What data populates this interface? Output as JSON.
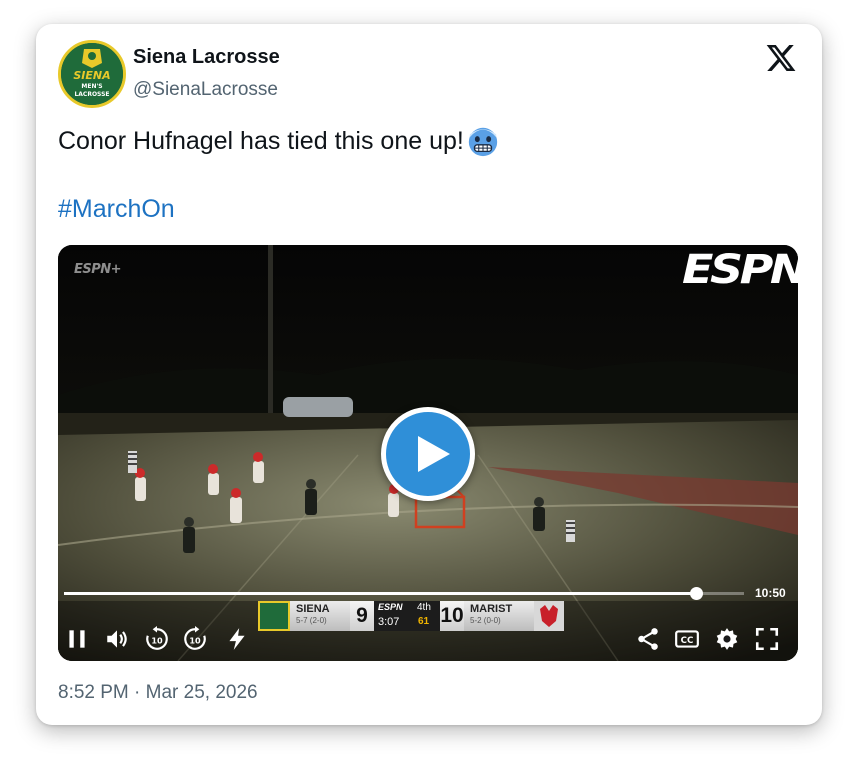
{
  "tweet": {
    "author_name": "Siena Lacrosse",
    "author_handle": "@SienaLacrosse",
    "avatar": {
      "text_line1": "SIENA",
      "text_line2": "MEN'S",
      "text_line3": "LACROSSE",
      "icon": "siena-lacrosse-logo"
    },
    "platform_icon": "x-logo-icon",
    "text": "Conor Hufnagel has tied this one up!",
    "emoji": "cold-face-emoji",
    "hashtag": "#MarchOn",
    "timestamp": "8:52 PM · Mar 25, 2026"
  },
  "video": {
    "watermark_small": "ESPN+",
    "network_logo": "ESPN",
    "progress_fraction": 0.93,
    "duration": "10:50",
    "scorebug": {
      "home_team": "SIENA",
      "home_record": "5-7 (2-0)",
      "home_score": "9",
      "away_team": "MARIST",
      "away_record": "5-2 (0-0)",
      "away_score": "10",
      "clock": "3:07",
      "period": "4th",
      "shot_clock": "61",
      "network_mini": "ESPN"
    },
    "controls": [
      "pause-icon",
      "volume-icon",
      "rewind-10-icon",
      "forward-10-icon",
      "lightning-icon",
      "share-icon",
      "captions-icon",
      "settings-icon",
      "fullscreen-icon"
    ],
    "accent_color": "#2f8fd8"
  }
}
